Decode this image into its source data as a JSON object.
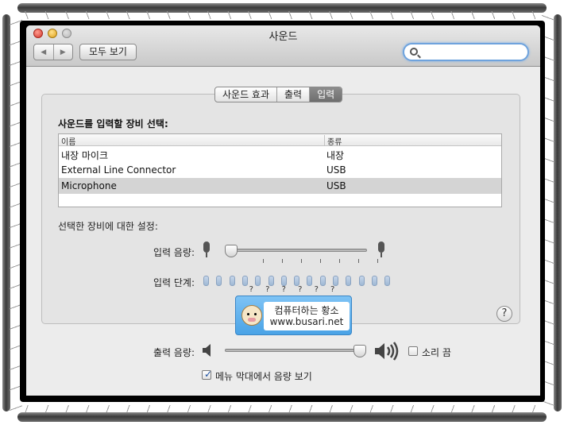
{
  "window": {
    "title": "사운드",
    "show_all_label": "모두 보기",
    "search_placeholder": ""
  },
  "tabs": [
    {
      "label": "사운드 효과",
      "active": false
    },
    {
      "label": "출력",
      "active": false
    },
    {
      "label": "입력",
      "active": true
    }
  ],
  "input": {
    "section_title": "사운드를 입력할 장비 선택:",
    "table_headers": {
      "name": "이름",
      "type": "종류"
    },
    "devices": [
      {
        "name": "내장 마이크",
        "type": "내장",
        "selected": false
      },
      {
        "name": "External Line Connector",
        "type": "USB",
        "selected": false
      },
      {
        "name": "Microphone",
        "type": "USB",
        "selected": true
      }
    ],
    "settings_title": "선택한 장비에 대한 설정:",
    "volume_label": "입력 음량:",
    "level_label": "입력 단계:",
    "volume_fraction": 0.0,
    "level_segments": 15,
    "help_label": "?"
  },
  "watermark": {
    "line1": "컴퓨터하는 황소",
    "line2": "www.busari.net",
    "dots": "? ? ? ? ? ?"
  },
  "output": {
    "volume_label": "출력 음량:",
    "volume_fraction": 1.0,
    "mute_label": "소리 끔",
    "mute_checked": false,
    "menubar_label": "메뉴 막대에서 음량 보기",
    "menubar_checked": true
  },
  "colors": {
    "selected_row": "#d4d4d4",
    "active_tab": "#7a7a7a",
    "search_focus": "#6fa3dd",
    "level_segment": "#b2c6de"
  }
}
